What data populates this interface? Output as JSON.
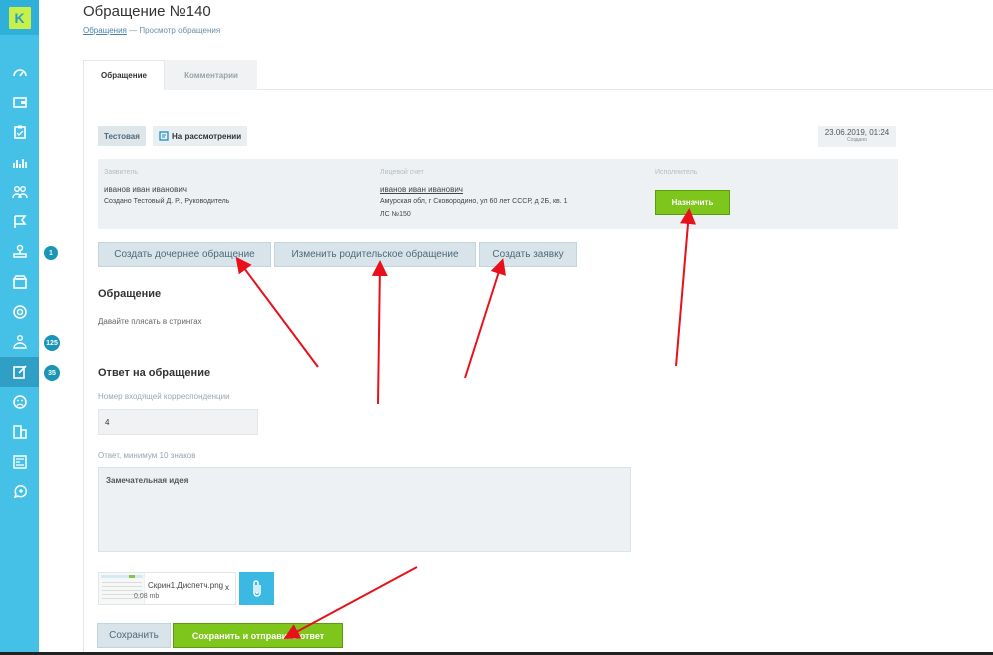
{
  "sidebar": {
    "logo": "K",
    "badges": [
      "1",
      "125",
      "35"
    ],
    "icons": [
      "dashboard-icon",
      "wallet-icon",
      "clipboard-icon",
      "chart-icon",
      "users-icon",
      "flag-icon",
      "stamp-icon",
      "box-icon",
      "coin-icon",
      "team-icon",
      "edit-icon",
      "sad-icon",
      "building-icon",
      "news-icon",
      "support-icon"
    ]
  },
  "page": {
    "title": "Обращение №140",
    "breadcrumb_link": "Обращения",
    "breadcrumb_sep": " — ",
    "breadcrumb_current": "Просмотр обращения"
  },
  "tabs": [
    "Обращение",
    "Комментарии"
  ],
  "tags": {
    "type": "Тестовая",
    "status": "На рассмотрении"
  },
  "date": {
    "value": "23.06.2019, 01:24",
    "label": "Создано"
  },
  "info": {
    "applicant_label": "Заявитель",
    "applicant_name": "иванов иван иванович",
    "created_by": "Создано Тестовый Д. Р., Руководитель",
    "account_label": "Лицевой счет",
    "account_name": "иванов иван иванович",
    "address": "Амурская обл, г Сковородино, ул 60 лет СССР, д 2Б, кв. 1",
    "account_number": "ЛС №150",
    "executor_label": "Исполнитель",
    "assign_button": "Назначить"
  },
  "actions": {
    "create_child": "Создать дочернее обращение",
    "change_parent": "Изменить родительское обращение",
    "create_request": "Создать заявку"
  },
  "request": {
    "heading": "Обращение",
    "text": "Давайте плясать в стрингах"
  },
  "answer": {
    "heading": "Ответ на обращение",
    "number_label": "Номер входящей корреспонденции",
    "number_value": "4",
    "text_label": "Ответ, минимум 10 знаков",
    "text_value": "Замечательная идея"
  },
  "attachment": {
    "name": "Скрин1.Диспетч.png",
    "size": "0.08 mb",
    "remove": "x"
  },
  "footer": {
    "save": "Сохранить",
    "save_send": "Сохранить и отправить ответ"
  },
  "colors": {
    "sidebar": "#45c1e7",
    "accent_green": "#7ec61b",
    "annotation_red": "#e8101a"
  }
}
